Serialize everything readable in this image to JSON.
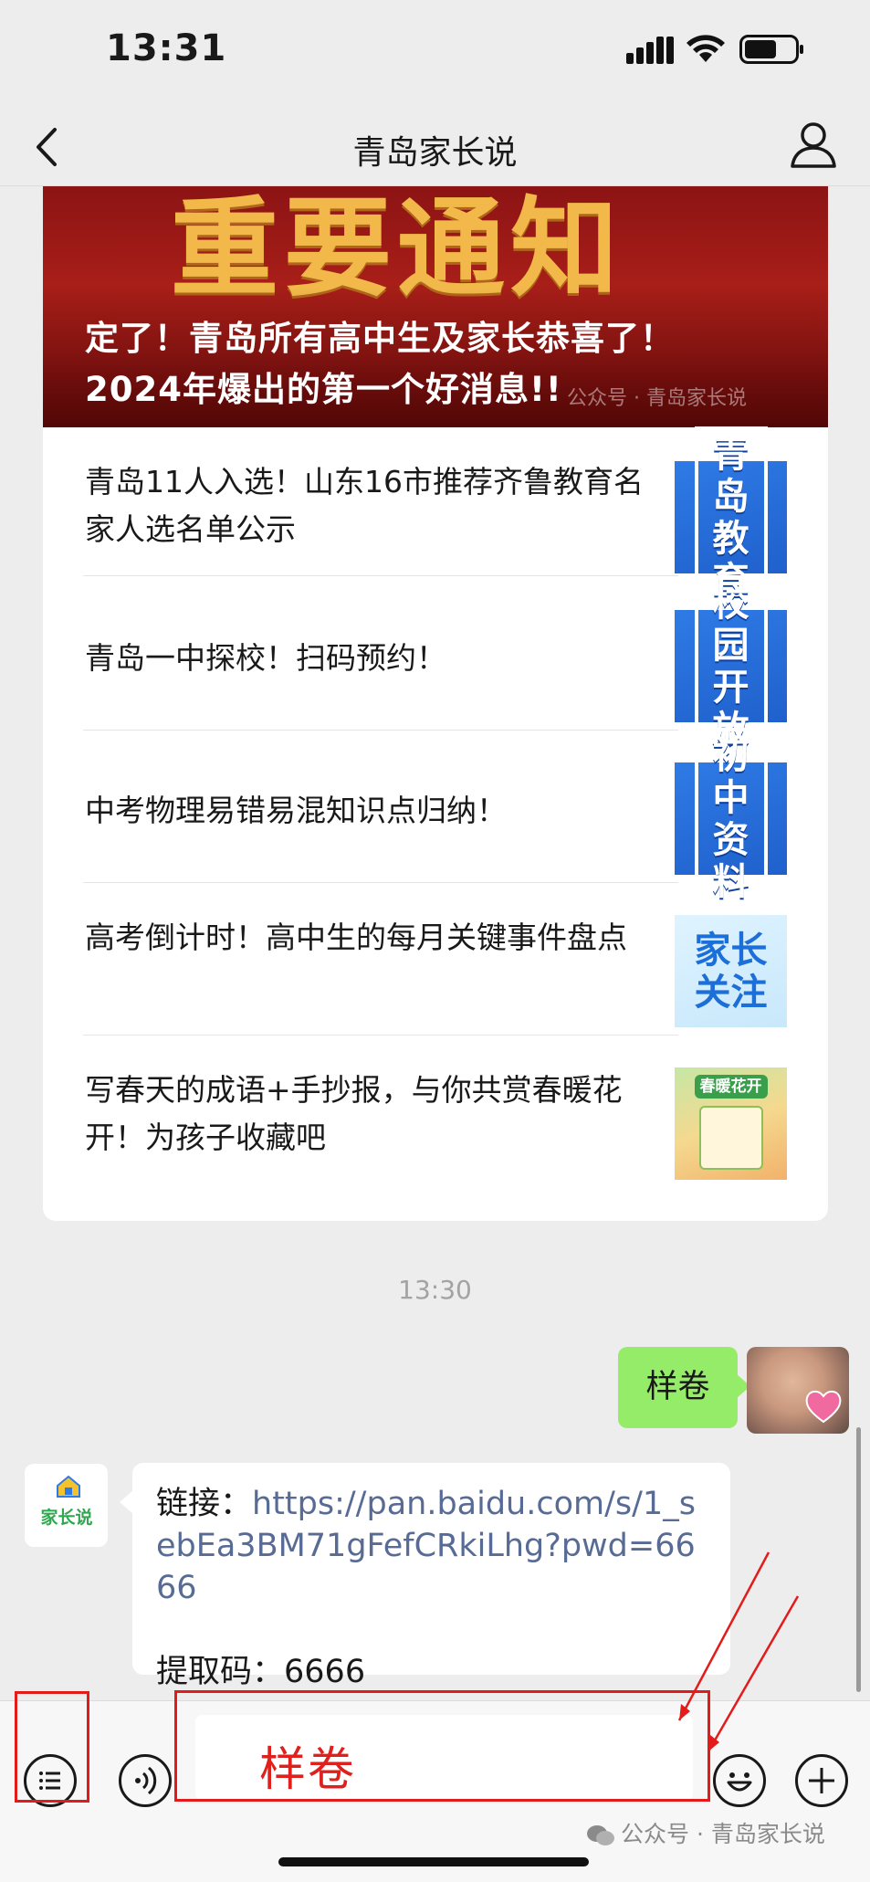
{
  "status_bar": {
    "time": "13:31"
  },
  "nav": {
    "title": "青岛家长说"
  },
  "banner": {
    "background_text": "重要通知",
    "line1": "定了！青岛所有高中生及家长恭喜了！",
    "line2": "2024年爆出的第一个好消息!!",
    "watermark": "公众号 · 青岛家长说"
  },
  "articles": [
    {
      "title": "青岛11人入选！山东16市推荐齐鲁教育名家人选名单公示",
      "thumb": "青岛教育"
    },
    {
      "title": "青岛一中探校！扫码预约！",
      "thumb": "校园开放"
    },
    {
      "title": "中考物理易错易混知识点归纳！",
      "thumb": "初中资料"
    },
    {
      "title": "高考倒计时！高中生的每月关键事件盘点",
      "thumb": "家长关注"
    },
    {
      "title": "写春天的成语+手抄报，与你共赏春暖花开！为孩子收藏吧",
      "thumb": "春暖花开"
    }
  ],
  "chat": {
    "timestamp": "13:30",
    "sent_message": "样卷",
    "received": {
      "avatar_text": "家长说",
      "link_label": "链接：",
      "link": "https://pan.baidu.com/s/1_sebEa3BM71gFefCRkiLhg?pwd=6666",
      "code_label": "提取码：",
      "code": "6666"
    }
  },
  "input": {
    "value": "样卷"
  },
  "watermark": "公众号 · 青岛家长说",
  "colors": {
    "sent_bubble": "#95ec69",
    "link": "#576b95",
    "annotation": "#e31b1b"
  }
}
